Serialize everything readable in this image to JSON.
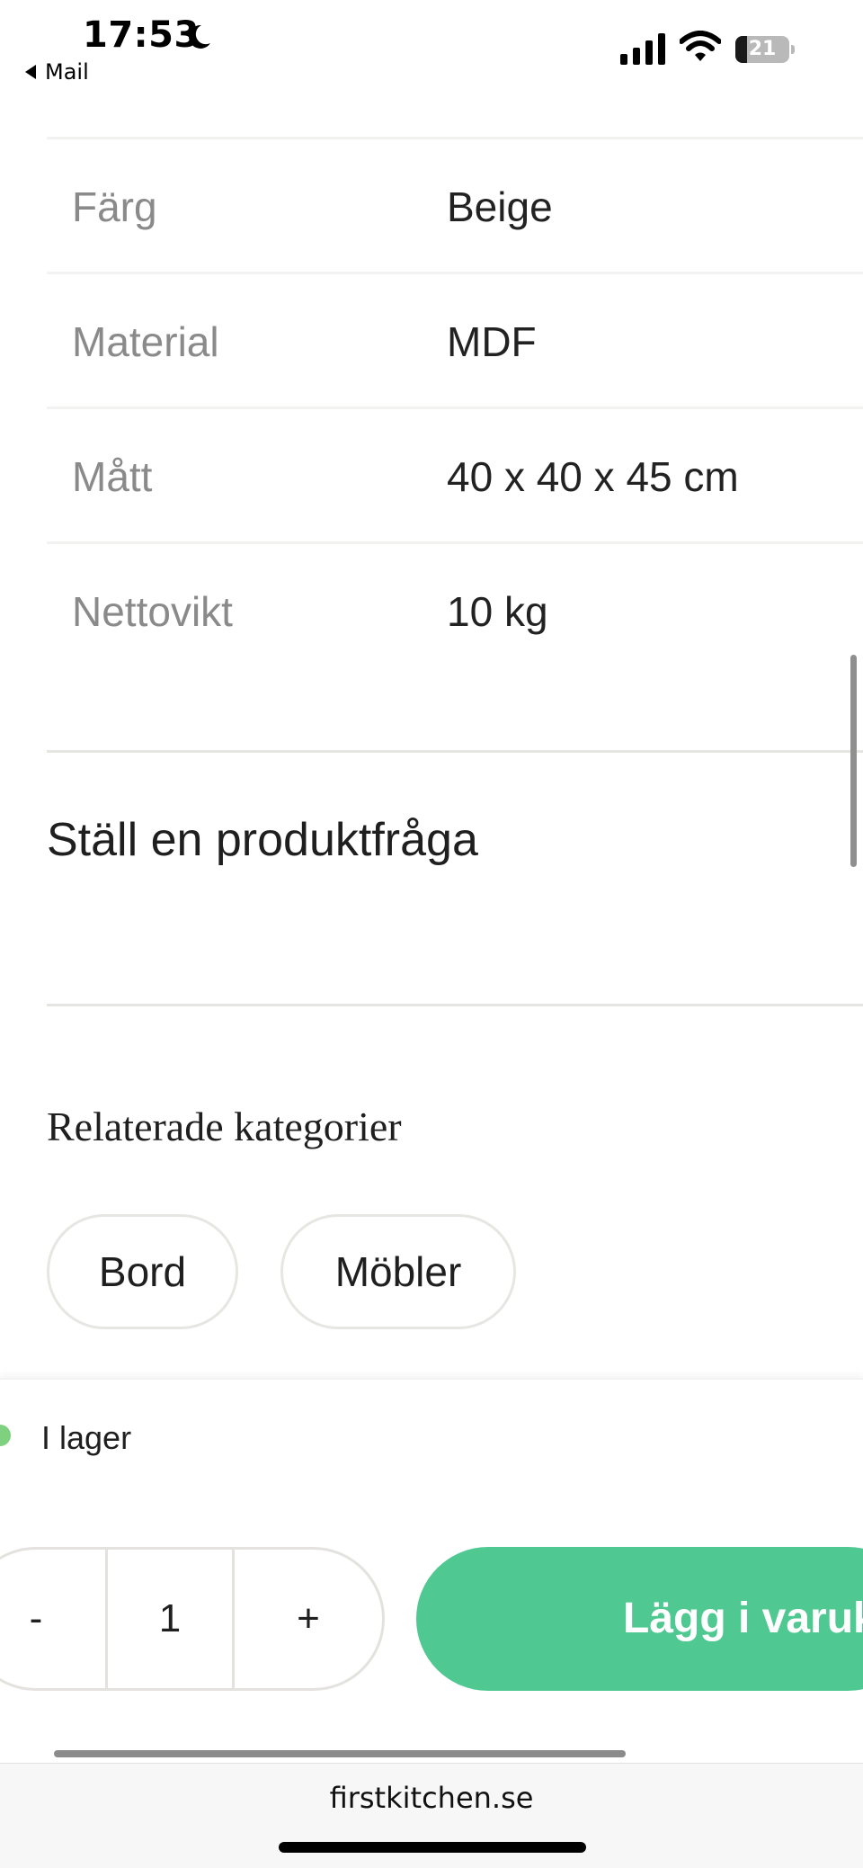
{
  "status_bar": {
    "time": "17:53",
    "back_label": "Mail",
    "battery_percent": "21",
    "battery_level": 0.21
  },
  "specs": [
    {
      "label": "Färg",
      "value": "Beige"
    },
    {
      "label": "Material",
      "value": "MDF"
    },
    {
      "label": "Mått",
      "value": "40 x 40 x 45 cm"
    },
    {
      "label": "Nettovikt",
      "value": "10 kg"
    }
  ],
  "product_question": "Ställ en produktfråga",
  "related": {
    "title": "Relaterade kategorier",
    "categories": [
      "Bord",
      "Möbler"
    ]
  },
  "buy_panel": {
    "stock_status": "I lager",
    "stock_color": "#7fd07f",
    "qty_minus": "-",
    "qty_value": "1",
    "qty_plus": "+",
    "add_to_cart": "Lägg i varukorg",
    "accent_color": "#4fc991"
  },
  "browser": {
    "url": "firstkitchen.se"
  }
}
